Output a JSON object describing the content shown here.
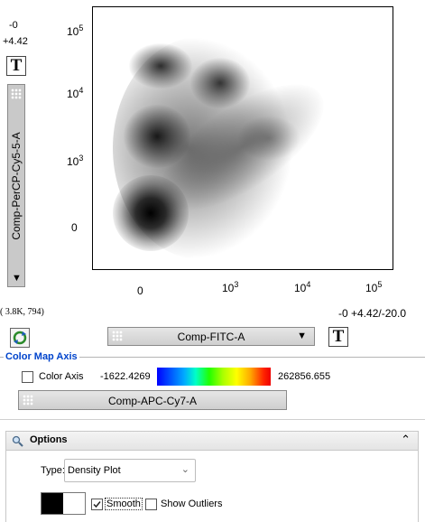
{
  "y_axis": {
    "min_label": "-0",
    "max_label": "+4.42",
    "t_button": "T",
    "parameter": "Comp-PerCP-Cy5-5-A",
    "ticks": [
      {
        "label": "10",
        "exp": "5"
      },
      {
        "label": "10",
        "exp": "4"
      },
      {
        "label": "10",
        "exp": "3"
      },
      {
        "label": "0",
        "exp": ""
      }
    ]
  },
  "x_axis": {
    "ticks": [
      {
        "label": "0",
        "exp": ""
      },
      {
        "label": "10",
        "exp": "3"
      },
      {
        "label": "10",
        "exp": "4"
      },
      {
        "label": "10",
        "exp": "5"
      }
    ],
    "range_label": "-0 +4.42/-20.0",
    "parameter": "Comp-FITC-A",
    "t_button": "T"
  },
  "coordinates": "( 3.8K,  794)",
  "color_map": {
    "title": "Color Map Axis",
    "checkbox_label": "Color Axis",
    "checked": false,
    "min_value": "-1622.4269",
    "max_value": "262856.655",
    "parameter": "Comp-APC-Cy7-A"
  },
  "options": {
    "title": "Options",
    "type_label": "Type:",
    "type_value": "Density Plot",
    "smooth_label": "Smooth",
    "smooth_checked": true,
    "outliers_label": "Show Outliers",
    "outliers_checked": false
  },
  "colors": {
    "accent": "#0044cc",
    "plot_density": "#000000"
  }
}
